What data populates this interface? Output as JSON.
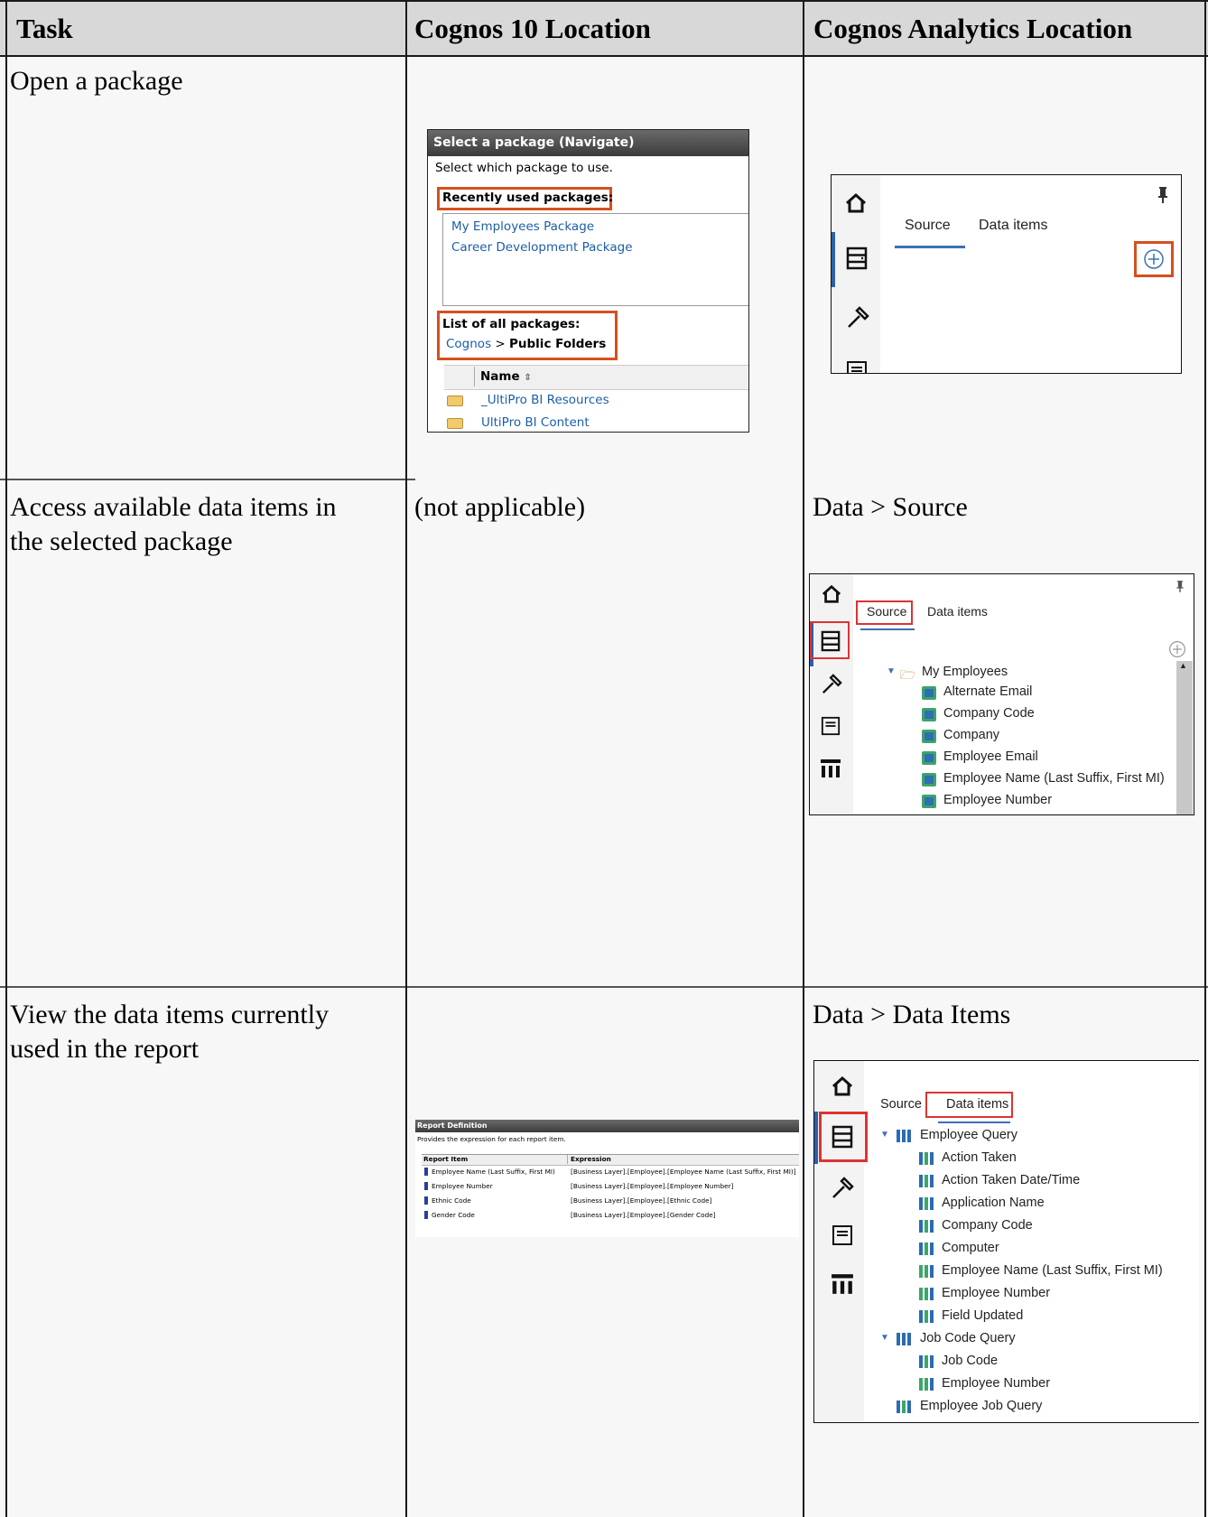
{
  "table": {
    "headers": [
      "Task",
      "Cognos 10 Location",
      "Cognos Analytics Location"
    ],
    "rows": [
      {
        "task": "Open a package",
        "c10": "",
        "ca": ""
      },
      {
        "task_lines": [
          "Access available data items in",
          "the selected package"
        ],
        "c10": "(not applicable)",
        "ca": "Data > Source"
      },
      {
        "task_lines": [
          "View the data items currently",
          "used in the report"
        ],
        "c10": "",
        "ca": "Data > Data Items"
      }
    ]
  },
  "package_dialog": {
    "title": "Select a package (Navigate)",
    "instruction": "Select which package to use.",
    "recent_label": "Recently used packages:",
    "recent": [
      "My Employees Package",
      "Career Development Package"
    ],
    "all_label": "List of all packages:",
    "breadcrumb_root": "Cognos",
    "breadcrumb_sep": ">",
    "breadcrumb_current": "Public Folders",
    "column_name": "Name",
    "folders": [
      "_UltiPro BI Resources",
      "UltiPro BI Content"
    ]
  },
  "ca_panel_1": {
    "tabs": [
      "Source",
      "Data items"
    ]
  },
  "ca_panel_2": {
    "tabs": [
      "Source",
      "Data items"
    ],
    "root": "My Employees",
    "items": [
      "Alternate Email",
      "Company Code",
      "Company",
      "Employee Email",
      "Employee Name (Last Suffix, First MI)",
      "Employee Number"
    ]
  },
  "ca_panel_3": {
    "tabs": [
      "Source",
      "Data items"
    ],
    "query1": "Employee Query",
    "query1_items": [
      "Action Taken",
      "Action Taken Date/Time",
      "Application Name",
      "Company Code",
      "Computer",
      "Employee Name (Last Suffix, First MI)",
      "Employee Number",
      "Field Updated"
    ],
    "query2": "Job Code Query",
    "query2_items": [
      "Job Code",
      "Employee Number"
    ],
    "query3": "Employee Job Query"
  },
  "report_definition": {
    "title": "Report Definition",
    "subtitle": "Provides the expression for each report item.",
    "col_item": "Report Item",
    "col_expr": "Expression",
    "rows": [
      {
        "item": "Employee Name (Last Suffix, First MI)",
        "expr": "[Business Layer].[Employee].[Employee Name (Last Suffix, First MI)]"
      },
      {
        "item": "Employee Number",
        "expr": "[Business Layer].[Employee].[Employee Number]"
      },
      {
        "item": "Ethnic Code",
        "expr": "[Business Layer].[Employee].[Ethnic Code]"
      },
      {
        "item": "Gender Code",
        "expr": "[Business Layer].[Employee].[Gender Code]"
      }
    ]
  }
}
